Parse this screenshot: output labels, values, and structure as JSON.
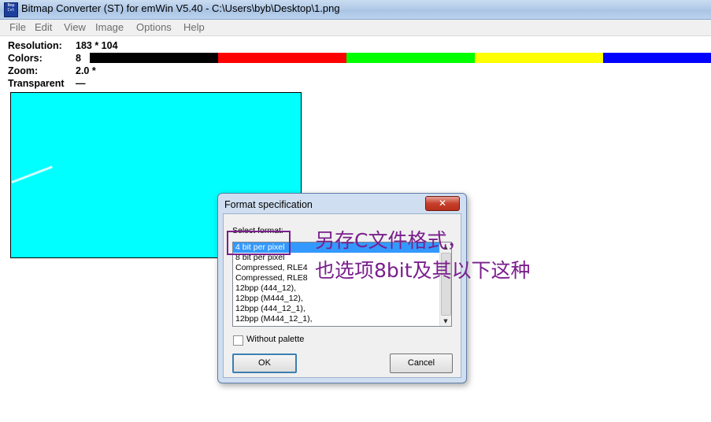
{
  "window": {
    "title": "Bitmap Converter (ST) for emWin V5.40 - C:\\Users\\byb\\Desktop\\1.png",
    "icon_text": "Bmp Cvt"
  },
  "menu": [
    "File",
    "Edit",
    "View",
    "Image",
    "Options",
    "Help"
  ],
  "info": {
    "resolution_label": "Resolution:",
    "resolution_value": "183 * 104",
    "colors_label": "Colors:",
    "colors_value": "8",
    "zoom_label": "Zoom:",
    "zoom_value": "2.0 *",
    "transparent_label": "Transparent",
    "transparent_value": "—"
  },
  "palette": [
    "#000000",
    "#ff0000",
    "#00ff00",
    "#ffff00",
    "#0000ff"
  ],
  "bitmap": {
    "background": "#00ffff"
  },
  "dialog": {
    "title": "Format specification",
    "close_icon": "close-icon",
    "select_label": "Select format:",
    "formats": [
      "4 bit per pixel",
      "8 bit per pixel",
      "Compressed, RLE4",
      "Compressed, RLE8",
      "12bpp (444_12),",
      "12bpp (M444_12),",
      "12bpp (444_12_1),",
      "12bpp (M444_12_1),"
    ],
    "selected_index": 0,
    "without_palette_label": "Without palette",
    "without_palette_checked": false,
    "ok_label": "OK",
    "cancel_label": "Cancel"
  },
  "annotation": {
    "line1": "另存C文件格式，",
    "line2": "也选项8bit及其以下这种",
    "color": "#7a1f8c"
  }
}
